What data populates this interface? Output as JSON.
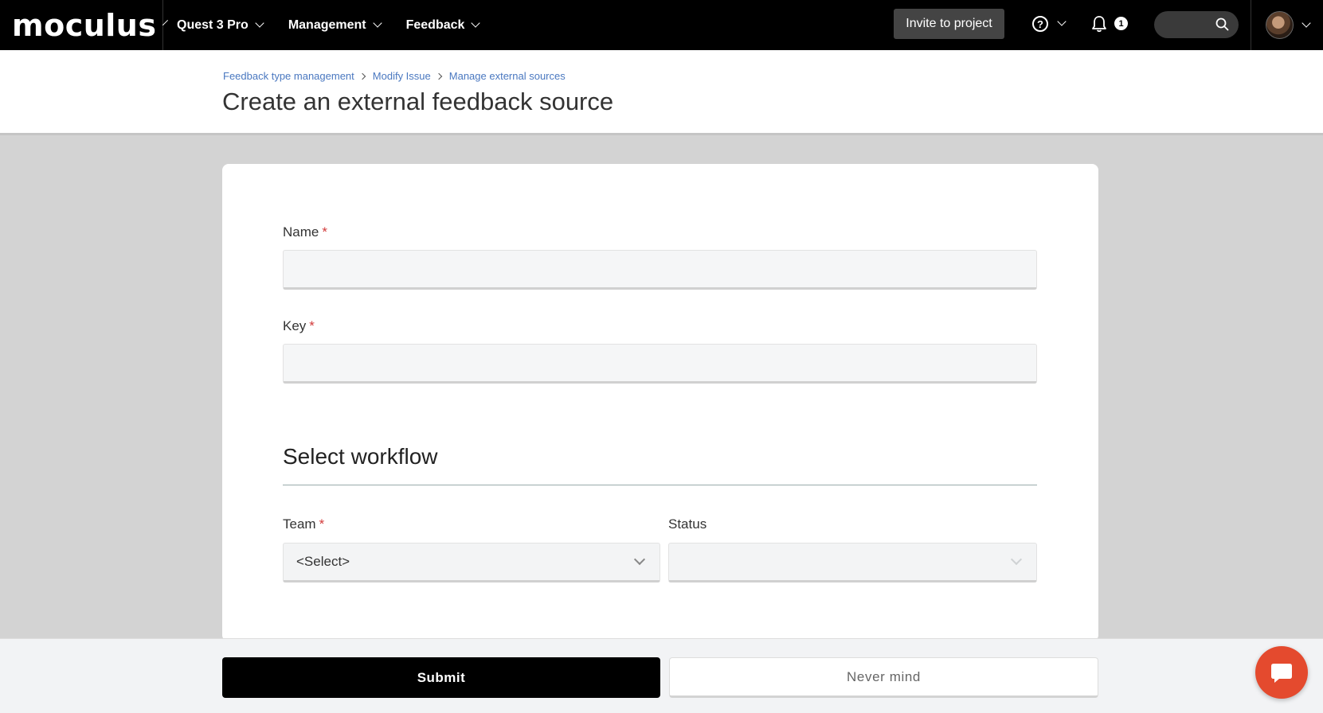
{
  "nav": {
    "logo": "moculus",
    "items": [
      {
        "label": "Quest 3 Pro"
      },
      {
        "label": "Management"
      },
      {
        "label": "Feedback"
      }
    ],
    "invite_label": "Invite to project",
    "help_glyph": "?",
    "notification_count": "1",
    "search_icon": "search-icon",
    "avatar_icon": "user-avatar"
  },
  "breadcrumb": [
    {
      "label": "Feedback type management"
    },
    {
      "label": "Modify Issue"
    },
    {
      "label": "Manage external sources"
    }
  ],
  "page": {
    "title": "Create an external feedback source"
  },
  "form": {
    "name": {
      "label": "Name",
      "required_mark": "*",
      "value": ""
    },
    "key": {
      "label": "Key",
      "required_mark": "*",
      "value": ""
    },
    "workflow_section_title": "Select workflow",
    "team": {
      "label": "Team",
      "required_mark": "*",
      "selected": "<Select>"
    },
    "status": {
      "label": "Status",
      "selected": "",
      "disabled": true
    }
  },
  "footer": {
    "submit_label": "Submit",
    "cancel_label": "Never mind"
  },
  "colors": {
    "nav_bg": "#000000",
    "accent_link": "#4a78c0",
    "required": "#d23b3b",
    "chat_button": "#e44a2e"
  },
  "chat_icon": "chat-bubble-icon"
}
